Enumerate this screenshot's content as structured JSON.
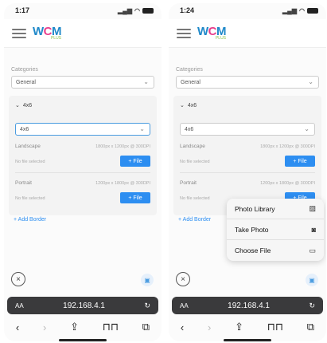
{
  "screens": [
    {
      "status": {
        "time": "1:17",
        "signal": ".ıl",
        "wifi": "wifi"
      },
      "logo": {
        "w": "W",
        "c": "C",
        "m": "M",
        "plus": "PLUS"
      },
      "category": {
        "label": "Categories",
        "value": "General"
      },
      "section": {
        "title": "4x6",
        "size_value": "4x6",
        "rows": [
          {
            "title": "Landscape",
            "dims": "1800px x 1200px @ 300DPI",
            "nofile": "No file selected",
            "button": "+ File"
          },
          {
            "title": "Portrait",
            "dims": "1200px x 1800px @ 300DPI",
            "nofile": "No file selected",
            "button": "+ File"
          }
        ]
      },
      "add_border": "+ Add Border",
      "browser": {
        "aa": "AA",
        "url": "192.168.4.1"
      }
    },
    {
      "status": {
        "time": "1:24",
        "signal": ".ıl",
        "wifi": "wifi"
      },
      "logo": {
        "w": "W",
        "c": "C",
        "m": "M",
        "plus": "PLUS"
      },
      "category": {
        "label": "Categories",
        "value": "General"
      },
      "section": {
        "title": "4x6",
        "size_value": "4x6",
        "rows": [
          {
            "title": "Landscape",
            "dims": "1800px x 1200px @ 300DPI",
            "nofile": "No file selected",
            "button": "+ File"
          },
          {
            "title": "Portrait",
            "dims": "1200px x 1800px @ 300DPI",
            "nofile": "No file selected",
            "button": "+ File"
          }
        ]
      },
      "add_border": "+ Add Border",
      "browser": {
        "aa": "AA",
        "url": "192.168.4.1"
      },
      "popup": {
        "items": [
          {
            "label": "Photo Library",
            "icon": "photo-library-icon"
          },
          {
            "label": "Take Photo",
            "icon": "camera-icon"
          },
          {
            "label": "Choose File",
            "icon": "folder-icon"
          }
        ]
      }
    }
  ]
}
